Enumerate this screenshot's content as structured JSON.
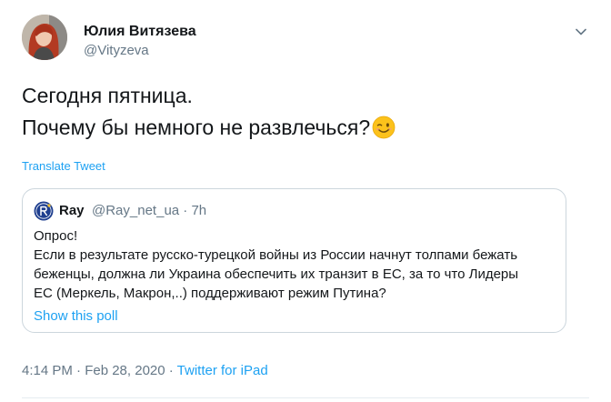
{
  "tweet": {
    "author": {
      "name": "Юлия Витязева",
      "handle": "@Vityzeva"
    },
    "text_lines": [
      "Сегодня пятница.",
      "Почему бы немного не развлечься?"
    ],
    "emoji": "winking-face-emoji",
    "translate_label": "Translate Tweet",
    "quoted": {
      "name": "Ray",
      "handle": "@Ray_net_ua",
      "separator": " · ",
      "time": "7h",
      "body_lines": [
        "Опрос!",
        "Если в результате русско-турецкой войны из России начнут толпами бежать",
        "беженцы, должна ли Украина обеспечить их транзит в ЕС, за то что Лидеры",
        "ЕС (Меркель, Макрон,..) поддерживают режим Путина?"
      ],
      "poll_link": "Show this poll"
    },
    "timestamp": "4:14 PM · Feb 28, 2020 · ",
    "source": "Twitter for iPad"
  },
  "icons": {
    "caret": "chevron-down-icon",
    "quote_avatar": "ray-logo-icon"
  },
  "colors": {
    "link": "#1da1f2",
    "secondary_text": "#657786",
    "primary_text": "#14171a",
    "border": "#ccd6dd"
  }
}
